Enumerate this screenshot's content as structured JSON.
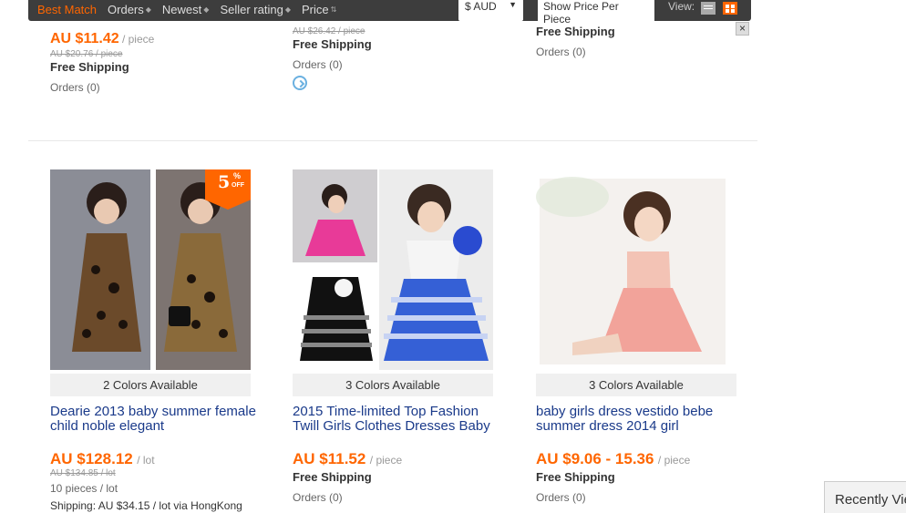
{
  "sortbar": {
    "items": [
      "Best Match",
      "Orders",
      "Newest",
      "Seller rating",
      "Price"
    ],
    "currency": "$ AUD",
    "price_per_piece": "Show Price Per Piece",
    "view_label": "View:"
  },
  "top_products": [
    {
      "price": "AU $11.42",
      "unit": "/ piece",
      "old_price": "AU $20.76 / piece",
      "shipping": "Free Shipping",
      "orders": "Orders (0)"
    },
    {
      "old_price": "AU $26.42 / piece",
      "shipping": "Free Shipping",
      "orders": "Orders (0)"
    },
    {
      "shipping": "Free Shipping",
      "orders": "Orders (0)"
    }
  ],
  "products": [
    {
      "colors": "2 Colors Available",
      "title": "Dearie 2013 baby summer female child noble elegant",
      "price": "AU $128.12",
      "unit": "/ lot",
      "old_price": "AU $134.85 / lot",
      "pieces": "10 pieces / lot",
      "shipping": "Shipping: AU $34.15 / lot via HongKong",
      "discount": "5",
      "discount_pct": "%",
      "discount_off": "OFF"
    },
    {
      "colors": "3 Colors Available",
      "title": "2015 Time-limited Top Fashion Twill Girls Clothes Dresses Baby",
      "price": "AU $11.52",
      "unit": "/ piece",
      "shipping": "Free Shipping",
      "orders": "Orders (0)"
    },
    {
      "colors": "3 Colors Available",
      "title": "baby girls dress vestido bebe summer dress 2014 girl",
      "price": "AU $9.06 - 15.36",
      "unit": "/ piece",
      "shipping": "Free Shipping",
      "orders": "Orders (0)"
    }
  ],
  "recently_viewed": "Recently Viewed",
  "colors": {
    "accent": "#ff6600",
    "title_link": "#1a3a8a",
    "bar": "#3d3d3d"
  }
}
